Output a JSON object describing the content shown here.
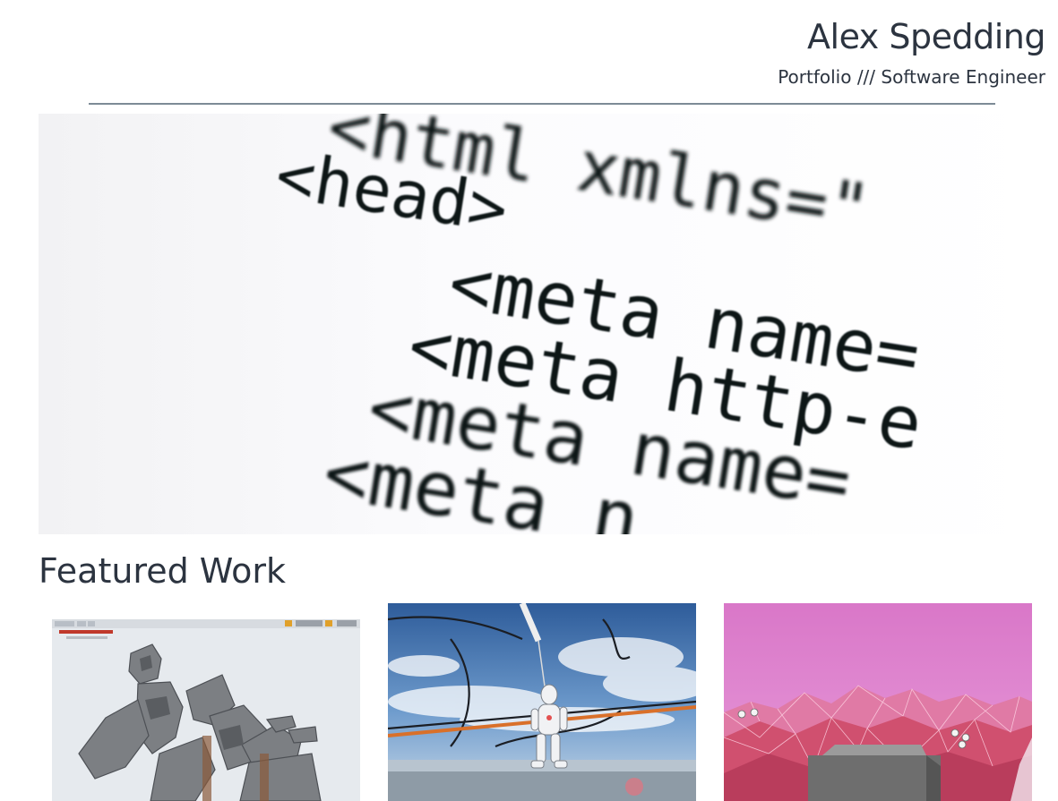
{
  "header": {
    "title": "Alex Spedding",
    "subtitle": "Portfolio /// Software Engineer"
  },
  "hero": {
    "icon": "html-code-closeup-image",
    "code_lines": [
      "<html xmlns=\"",
      "<head>",
      "<meta name=",
      "<meta http-e",
      "<meta name=",
      "<meta n"
    ]
  },
  "featured": {
    "heading": "Featured Work",
    "projects": [
      {
        "icon": "game-editor-statue-screenshot",
        "accent": "#8a8d91"
      },
      {
        "icon": "robot-sky-screenshot",
        "accent": "#3f6fa8"
      },
      {
        "icon": "pink-low-poly-terrain-screenshot",
        "accent": "#d67fc2"
      }
    ]
  },
  "colors": {
    "text": "#2c3440",
    "divider": "#7d8b96",
    "background": "#ffffff"
  }
}
